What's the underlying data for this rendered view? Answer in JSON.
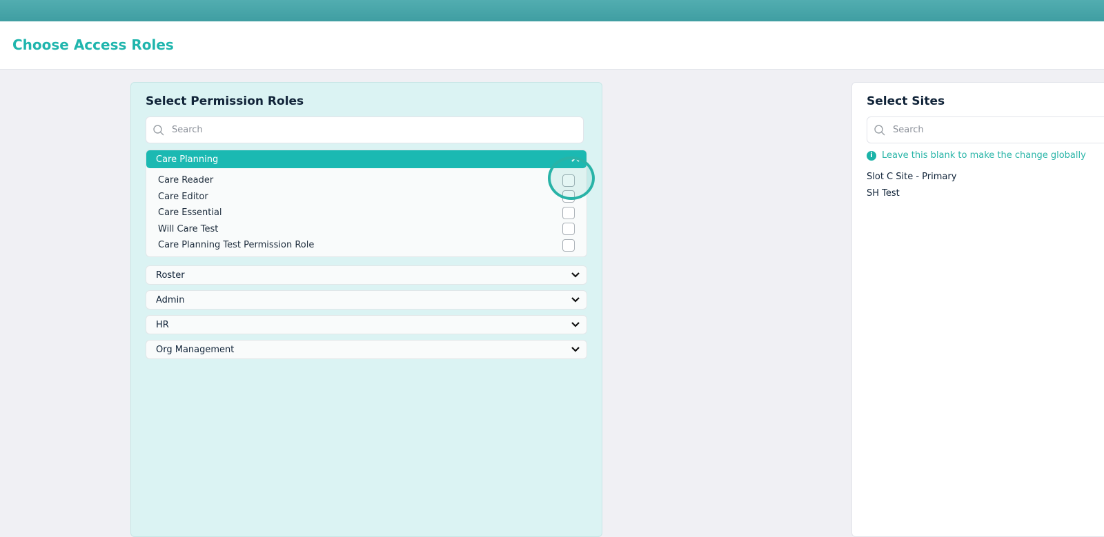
{
  "header": {
    "title": "Choose Access Roles"
  },
  "roles": {
    "title": "Select Permission Roles",
    "search_placeholder": "Search",
    "groups": [
      {
        "label": "Care Planning",
        "expanded": true,
        "items": [
          "Care Reader",
          "Care Editor",
          "Care Essential",
          "Will Care Test",
          "Care Planning Test Permission Role"
        ]
      },
      {
        "label": "Roster",
        "expanded": false
      },
      {
        "label": "Admin",
        "expanded": false
      },
      {
        "label": "HR",
        "expanded": false
      },
      {
        "label": "Org Management",
        "expanded": false
      }
    ]
  },
  "sites": {
    "title": "Select Sites",
    "search_placeholder": "Search",
    "info": "Leave this blank to make the change globally",
    "items": [
      "Slot C Site - Primary",
      "SH Test"
    ]
  },
  "colors": {
    "accent": "#1bb9b2",
    "panel": "#dbf3f3"
  }
}
